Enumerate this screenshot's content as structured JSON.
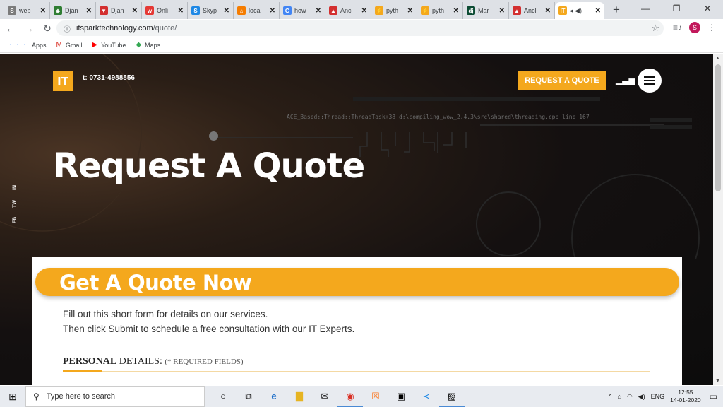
{
  "browser": {
    "tabs": [
      {
        "title": "web",
        "icon": "S",
        "color": "#7b7b7b"
      },
      {
        "title": "Djan",
        "icon": "◈",
        "color": "#2e7d32"
      },
      {
        "title": "Djan",
        "icon": "▼",
        "color": "#d32f2f"
      },
      {
        "title": "Onli",
        "icon": "ᴡ",
        "color": "#e53935"
      },
      {
        "title": "Skyp",
        "icon": "S",
        "color": "#1e88e5"
      },
      {
        "title": "local",
        "icon": "⌂",
        "color": "#f57c00"
      },
      {
        "title": "how",
        "icon": "G",
        "color": "#4285f4"
      },
      {
        "title": "Ancl",
        "icon": "▲",
        "color": "#d32f2f"
      },
      {
        "title": "pyth",
        "icon": "⚡",
        "color": "#f4a81d"
      },
      {
        "title": "pyth",
        "icon": "⚡",
        "color": "#f4a81d"
      },
      {
        "title": "Mar",
        "icon": "dj",
        "color": "#0c4b33"
      },
      {
        "title": "Ancl",
        "icon": "▲",
        "color": "#d32f2f"
      }
    ],
    "active_tab": {
      "icon": "IT",
      "title": "◂ ◀)",
      "color": "#f4a81d"
    },
    "new_tab": "+",
    "url_host": "itsparktechnology.com",
    "url_path": "/quote/",
    "profile_initial": "S",
    "bookmarks": [
      {
        "label": "Apps",
        "icon": "⋮⋮⋮"
      },
      {
        "label": "Gmail",
        "icon": "M"
      },
      {
        "label": "YouTube",
        "icon": "▶"
      },
      {
        "label": "Maps",
        "icon": "◆"
      }
    ]
  },
  "site": {
    "logo": "IT",
    "phone": "t: 0731-4988856",
    "cta": "REQUEST A QUOTE",
    "code_text": "ACE_Based::Thread::ThreadTask+38  d:\\compiling_wow_2.4.3\\src\\shared\\threading.cpp line 167",
    "hero_title": "Request A Quote",
    "social": [
      "IN",
      "TW",
      "FB"
    ],
    "form": {
      "heading": "Get A Quote Now",
      "intro_1": "Fill out this short form for details on our services.",
      "intro_2": "Then click Submit to schedule a free consultation with our IT Experts.",
      "section_bold": "PERSONAL",
      "section_rest": "DETAILS:",
      "section_note": "(* REQUIRED FIELDS)"
    }
  },
  "taskbar": {
    "search_placeholder": "Type here to search",
    "lang": "ENG",
    "time": "12:55",
    "date": "14-01-2020"
  }
}
